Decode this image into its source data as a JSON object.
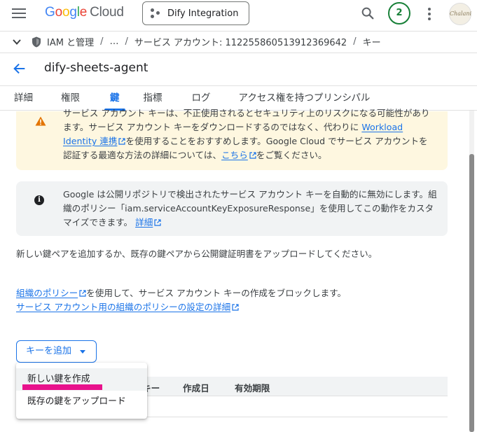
{
  "header": {
    "logo_google": [
      "G",
      "o",
      "o",
      "g",
      "l",
      "e"
    ],
    "logo_cloud": "Cloud",
    "project_name": "Dify Integration",
    "notification_count": "2",
    "avatar_text": "Chalani"
  },
  "breadcrumb": {
    "items": [
      "IAM と管理",
      "…",
      "サービス アカウント: 112255860513912369642",
      "キー"
    ],
    "separator": "/"
  },
  "page": {
    "title": "dify-sheets-agent"
  },
  "tabs": [
    {
      "label": "詳細",
      "active": false
    },
    {
      "label": "権限",
      "active": false
    },
    {
      "label": "鍵",
      "active": true
    },
    {
      "label": "指標",
      "active": false
    },
    {
      "label": "ログ",
      "active": false
    },
    {
      "label": "アクセス権を持つプリンシパル",
      "active": false
    }
  ],
  "warning": {
    "text1": "サービス アカウント キーは、不正使用されるとセキュリティ上のリスクになる可能性があります。サービス アカウント キーをダウンロードするのではなく、代わりに ",
    "link1": "Workload Identity 連携",
    "text2": "を使用することをおすすめします。Google Cloud でサービス アカウントを認証する最適な方法の詳細については、",
    "link2": "こちら",
    "text3": "をご覧ください。"
  },
  "info": {
    "text": "Google は公開リポジトリで検出されたサービス アカウント キーを自動的に無効にします。組織のポリシー「iam.serviceAccountKeyExposureResponse」を使用してこの動作をカスタマイズできます。 ",
    "link": "詳細"
  },
  "content": {
    "para1": "新しい鍵ペアを追加するか、既存の鍵ペアから公開鍵証明書をアップロードしてください。",
    "policy_link": "組織のポリシー",
    "para2_text": "を使用して、サービス アカウント キーの作成をブロックします。",
    "policy_details_link": "サービス アカウント用の組織のポリシーの設定の詳細"
  },
  "add_key_button": "キーを追加",
  "table": {
    "columns": [
      "キー",
      "作成日",
      "有効期限"
    ]
  },
  "dropdown_menu": {
    "items": [
      "新しい鍵を作成",
      "既存の鍵をアップロード"
    ]
  },
  "colors": {
    "accent": "#1a73e8",
    "warning_bg": "#fef7e0",
    "info_bg": "#f1f3f4",
    "annotation": "#e8128c"
  }
}
